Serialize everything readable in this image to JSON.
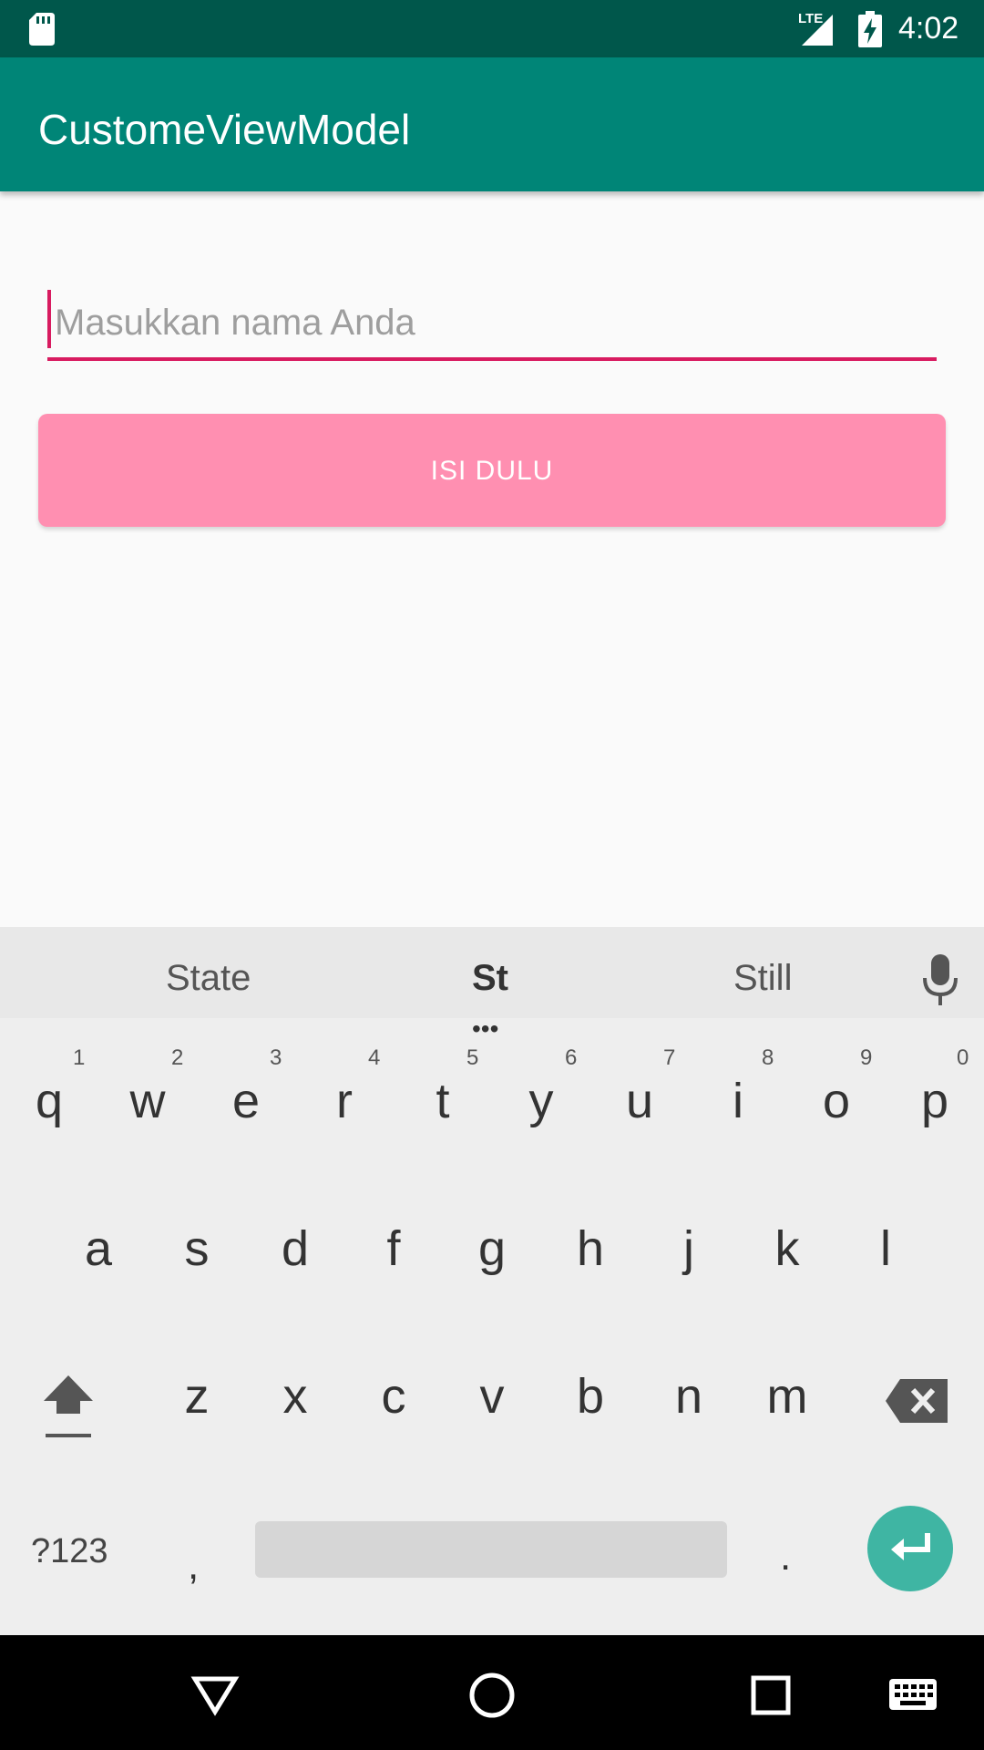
{
  "status_bar": {
    "network": "LTE",
    "time": "4:02"
  },
  "app_bar": {
    "title": "CustomeViewModel"
  },
  "form": {
    "name_placeholder": "Masukkan nama Anda",
    "name_value": "",
    "submit_label": "ISI DULU"
  },
  "keyboard": {
    "suggestions": [
      "State",
      "St",
      "Still"
    ],
    "suggestion_more": "•••",
    "row1": [
      "q",
      "w",
      "e",
      "r",
      "t",
      "y",
      "u",
      "i",
      "o",
      "p"
    ],
    "row1_hints": [
      "1",
      "2",
      "3",
      "4",
      "5",
      "6",
      "7",
      "8",
      "9",
      "0"
    ],
    "row2": [
      "a",
      "s",
      "d",
      "f",
      "g",
      "h",
      "j",
      "k",
      "l"
    ],
    "row3": [
      "z",
      "x",
      "c",
      "v",
      "b",
      "n",
      "m"
    ],
    "symbols_label": "?123",
    "comma": ",",
    "period": "."
  },
  "colors": {
    "status_bar": "#00574b",
    "app_bar": "#008577",
    "accent": "#d81b60",
    "button": "#ff8fb1",
    "enter": "#3fb5a3"
  }
}
